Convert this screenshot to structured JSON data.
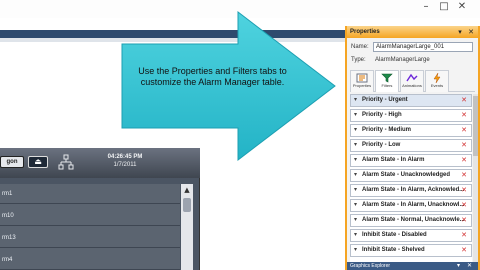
{
  "window": {
    "minimize": "–",
    "maximize": "□",
    "close": "✕"
  },
  "callout": {
    "text": "Use the Properties and Filters tabs to customize the Alarm Manager table."
  },
  "alarm_manager": {
    "button_label": "gon",
    "button2_icon": "eject-icon",
    "time": "04:26:45 PM",
    "date": "1/7/2011",
    "rows": [
      "rm1",
      "m10",
      "rm13",
      "rm4"
    ]
  },
  "properties": {
    "title": "Properties",
    "header_buttons": [
      "▾",
      "✕"
    ],
    "name_label": "Name:",
    "name_value": "AlarmManagerLarge_001",
    "type_label": "Type:",
    "type_value": "AlarmManagerLarge",
    "tabs": [
      {
        "label": "Properties",
        "icon": "properties-icon"
      },
      {
        "label": "Filters",
        "icon": "filters-icon"
      },
      {
        "label": "Animations",
        "icon": "animations-icon"
      },
      {
        "label": "Events",
        "icon": "events-icon"
      }
    ],
    "active_tab": "Filters",
    "filters": [
      "Priority - Urgent",
      "Priority - High",
      "Priority - Medium",
      "Priority - Low",
      "Alarm State - In Alarm",
      "Alarm State - Unacknowledged",
      "Alarm State - In Alarm, Acknowled...",
      "Alarm State - In Alarm, Unacknowl...",
      "Alarm State - Normal, Unacknowle...",
      "Inhibit State - Disabled",
      "Inhibit State - Shelved"
    ],
    "explorer_title": "Graphics Explorer",
    "explorer_buttons": [
      "▾",
      "✕"
    ]
  },
  "colors": {
    "arrow": "#3fc8d6",
    "panel_border": "#f5a524",
    "delete_x": "#d12c2c"
  }
}
